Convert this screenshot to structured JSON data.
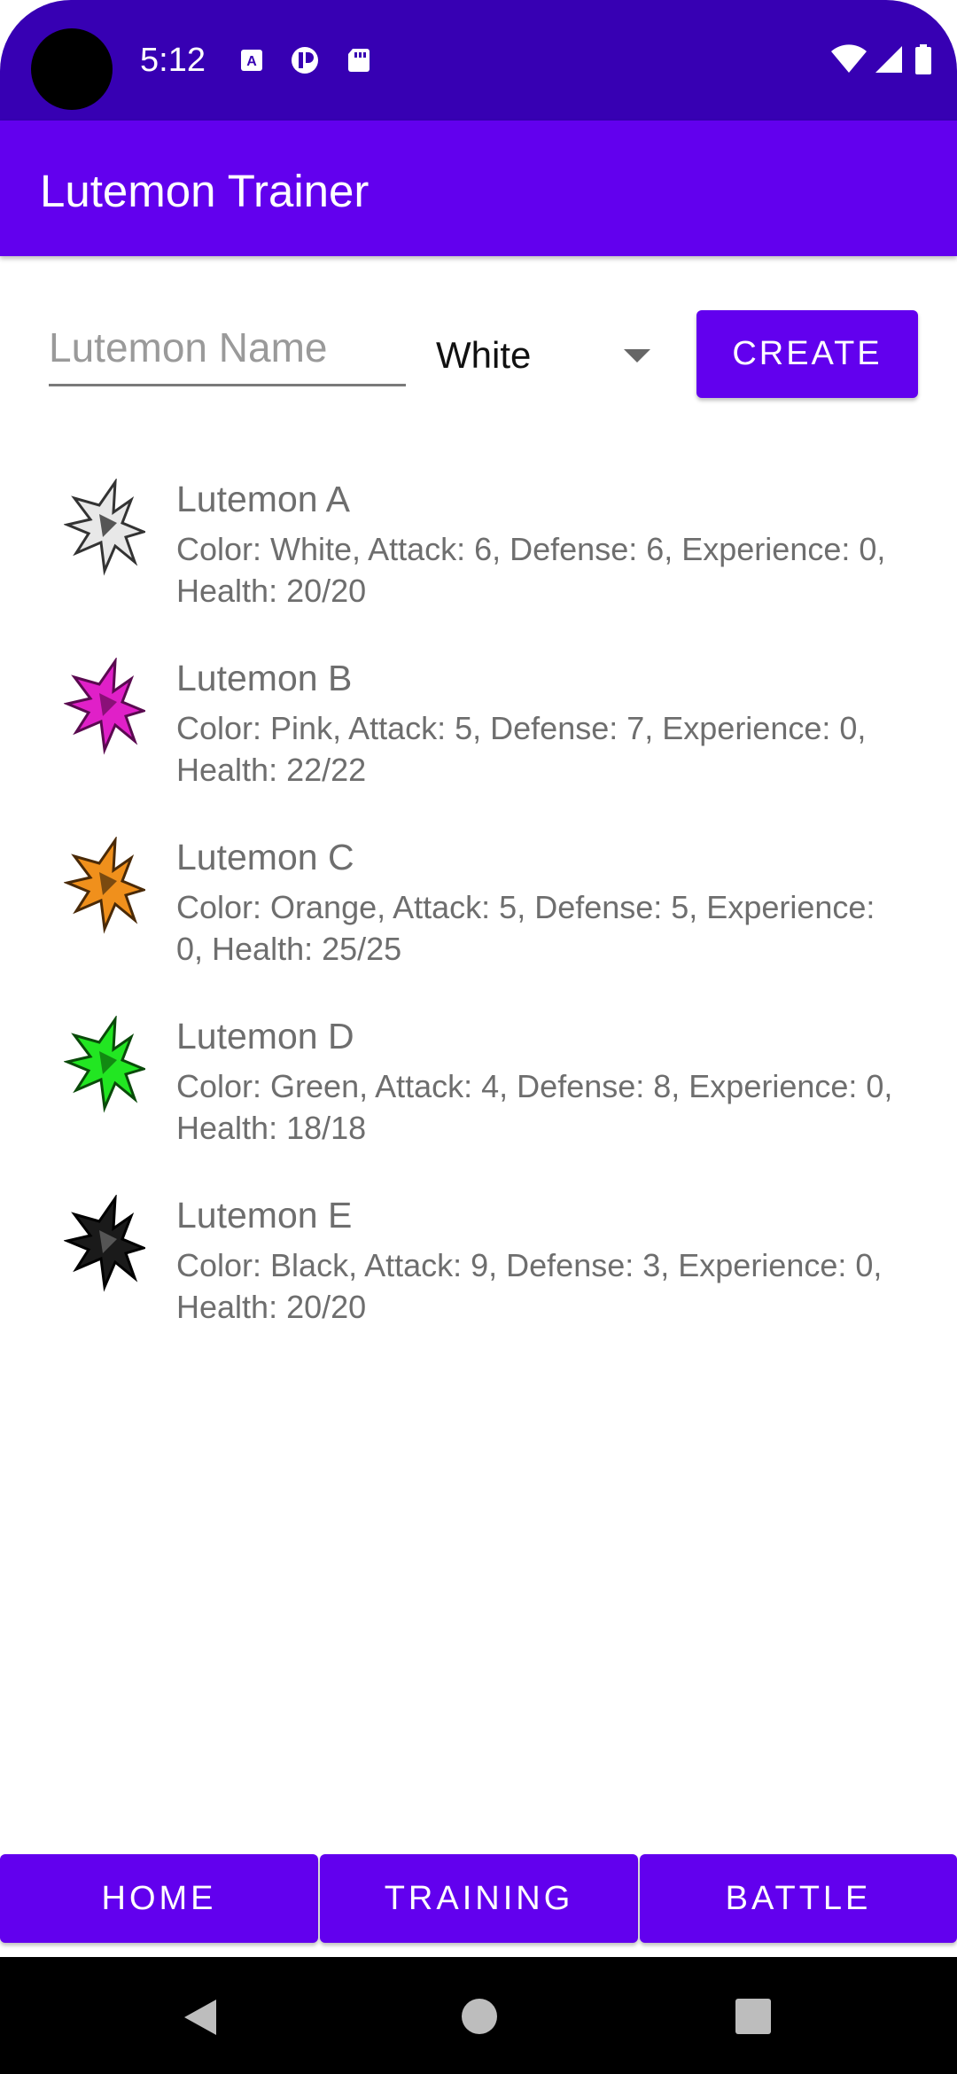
{
  "status_bar": {
    "time": "5:12"
  },
  "app_bar": {
    "title": "Lutemon Trainer"
  },
  "form": {
    "name_placeholder": "Lutemon Name",
    "name_value": "",
    "selected_color": "White",
    "create_label": "CREATE"
  },
  "lutemons": [
    {
      "name": "Lutemon A",
      "stats": "Color: White, Attack: 6, Defense: 6, Experience: 0, Health: 20/20",
      "color": "#e8e8e8"
    },
    {
      "name": "Lutemon B",
      "stats": "Color: Pink, Attack: 5, Defense: 7, Experience: 0, Health: 22/22",
      "color": "#e020c8"
    },
    {
      "name": "Lutemon C",
      "stats": "Color: Orange, Attack: 5, Defense: 5, Experience: 0, Health: 25/25",
      "color": "#f0901c"
    },
    {
      "name": "Lutemon D",
      "stats": "Color: Green, Attack: 4, Defense: 8, Experience: 0, Health: 18/18",
      "color": "#22e622"
    },
    {
      "name": "Lutemon E",
      "stats": "Color: Black, Attack: 9, Defense: 3, Experience: 0, Health: 20/20",
      "color": "#1a1a1a"
    }
  ],
  "bottom_nav": {
    "home_label": "HOME",
    "training_label": "TRAINING",
    "battle_label": "BATTLE"
  },
  "colors": {
    "primary": "#6200ee",
    "primary_dark": "#3700b3"
  },
  "icons": {
    "status": [
      "a-notification-icon",
      "data-saver-icon",
      "sd-card-icon",
      "wifi-icon",
      "signal-icon",
      "battery-icon"
    ],
    "system_nav": [
      "back-icon",
      "home-icon",
      "recents-icon"
    ]
  }
}
